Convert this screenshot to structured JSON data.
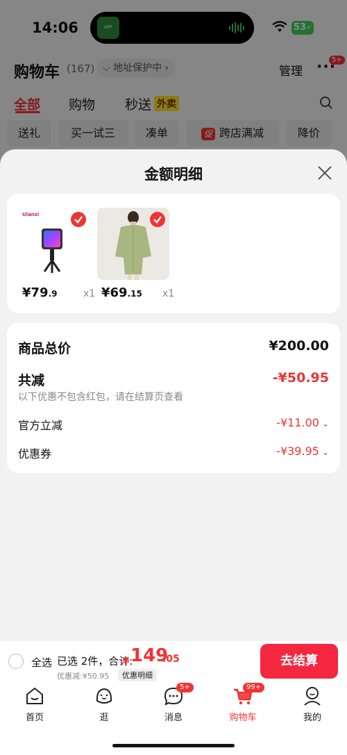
{
  "status_bar": {
    "time": "14:06",
    "battery": "53"
  },
  "header": {
    "title": "购物车",
    "count": "(167)",
    "address_tag": "地址保护中",
    "manage": "管理",
    "more_badge": "5+"
  },
  "tabs": [
    {
      "label": "全部"
    },
    {
      "label": "购物"
    },
    {
      "label": "秒送"
    }
  ],
  "takeout_tag": "外卖",
  "chips": [
    {
      "label": "送礼"
    },
    {
      "label": "买一试三"
    },
    {
      "label": "凑单"
    },
    {
      "label": "跨店满减",
      "tag": "促"
    },
    {
      "label": "降价"
    }
  ],
  "sheet": {
    "title": "金额明细",
    "items": [
      {
        "name": "fill-light",
        "price_main": "¥79",
        "price_dec": ".9",
        "qty": "x1",
        "brand": "Ulanzi"
      },
      {
        "name": "green-shirt",
        "price_main": "¥69",
        "price_dec": ".15",
        "qty": "x1"
      }
    ],
    "summary": {
      "total_label": "商品总价",
      "total_value": "¥200.00",
      "reduction_label": "共减",
      "reduction_value": "-¥50.95",
      "reduction_note": "以下优惠不包含红包，请在结算页查看",
      "official_label": "官方立减",
      "official_value": "-¥11.00",
      "coupon_label": "优惠券",
      "coupon_value": "-¥39.95"
    }
  },
  "bottom_bar": {
    "select_all": "全选",
    "selected_text": "已选 2件，合计:",
    "currency": "¥",
    "sum_int": "149",
    "sum_dec": ".05",
    "discount_text": "优惠减:¥50.95",
    "detail_label": "优惠明细",
    "checkout": "去结算"
  },
  "tabbar": [
    {
      "label": "首页"
    },
    {
      "label": "逛"
    },
    {
      "label": "消息",
      "badge": "5+"
    },
    {
      "label": "购物车",
      "badge": "99+"
    },
    {
      "label": "我的"
    }
  ],
  "colors": {
    "accent": "#f03434",
    "checkout": "#f5273f"
  }
}
